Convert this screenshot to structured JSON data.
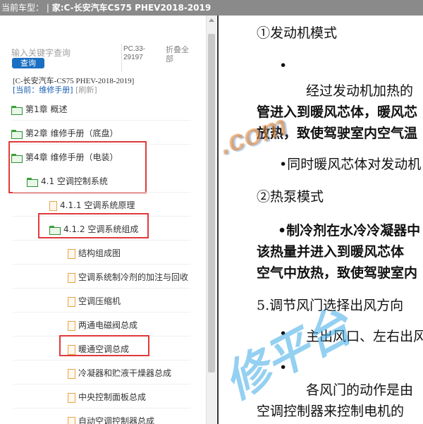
{
  "header": {
    "prefix": "当前车型：",
    "separator": "|",
    "model": "家:C-长安汽车CS75 PHEV2018-2019"
  },
  "search": {
    "placeholder": "输入关键字查询",
    "button_label": "查询",
    "pc_code": "PC.33-29197",
    "collapse_label": "折叠全部"
  },
  "current": {
    "model": "[C-长安汽车-CS75 PHEV-2018-2019]",
    "label": "[当前：维修手册]",
    "refresh": "[刷新]"
  },
  "tree": [
    {
      "label": "第1章 概述",
      "icon": "folder-icon"
    },
    {
      "label": "第2章 维修手册（底盘）",
      "icon": "folder-icon"
    },
    {
      "label": "第4章 维修手册（电装）",
      "icon": "folder-open-icon"
    },
    {
      "label": "4.1 空调控制系统",
      "icon": "folder-open-icon"
    },
    {
      "label": "4.1.1 空调系统原理",
      "icon": "document-icon"
    },
    {
      "label": "4.1.2 空调系统组成",
      "icon": "folder-open-icon"
    },
    {
      "label": "结构组成图",
      "icon": "document-icon"
    },
    {
      "label": "空调系统制冷剂的加注与回收",
      "icon": "document-icon"
    },
    {
      "label": "空调压缩机",
      "icon": "document-icon"
    },
    {
      "label": "两通电磁阀总成",
      "icon": "document-icon"
    },
    {
      "label": "暖通空调总成",
      "icon": "document-icon"
    },
    {
      "label": "冷凝器和贮液干燥器总成",
      "icon": "document-icon"
    },
    {
      "label": "中央控制面板总成",
      "icon": "document-icon"
    },
    {
      "label": "自动空调控制器总成",
      "icon": "document-icon"
    }
  ],
  "document": {
    "lines": [
      "①发动机模式",
      "•",
      "经过发动机加热的",
      "管进入到暖风芯体，暖风芯",
      "放热，致使驾驶室内空气温",
      "•同时暖风芯体对发动机",
      "②热泵模式",
      "•制冷剂在水冷冷凝器中",
      "该热量并进入到暖风芯体",
      "空气中放热，致使驾驶室内",
      "5.调节风门选择出风方向",
      "•",
      "主出风口、左右出风",
      "•",
      "各风门的动作是由",
      "空调控制器来控制电机的"
    ],
    "watermarks": [
      ".com",
      "修平台"
    ]
  },
  "colors": {
    "highlight": "#e03a3a",
    "button": "#1a6fc2",
    "folder": "#3aa53a",
    "document": "#e6a54a"
  }
}
